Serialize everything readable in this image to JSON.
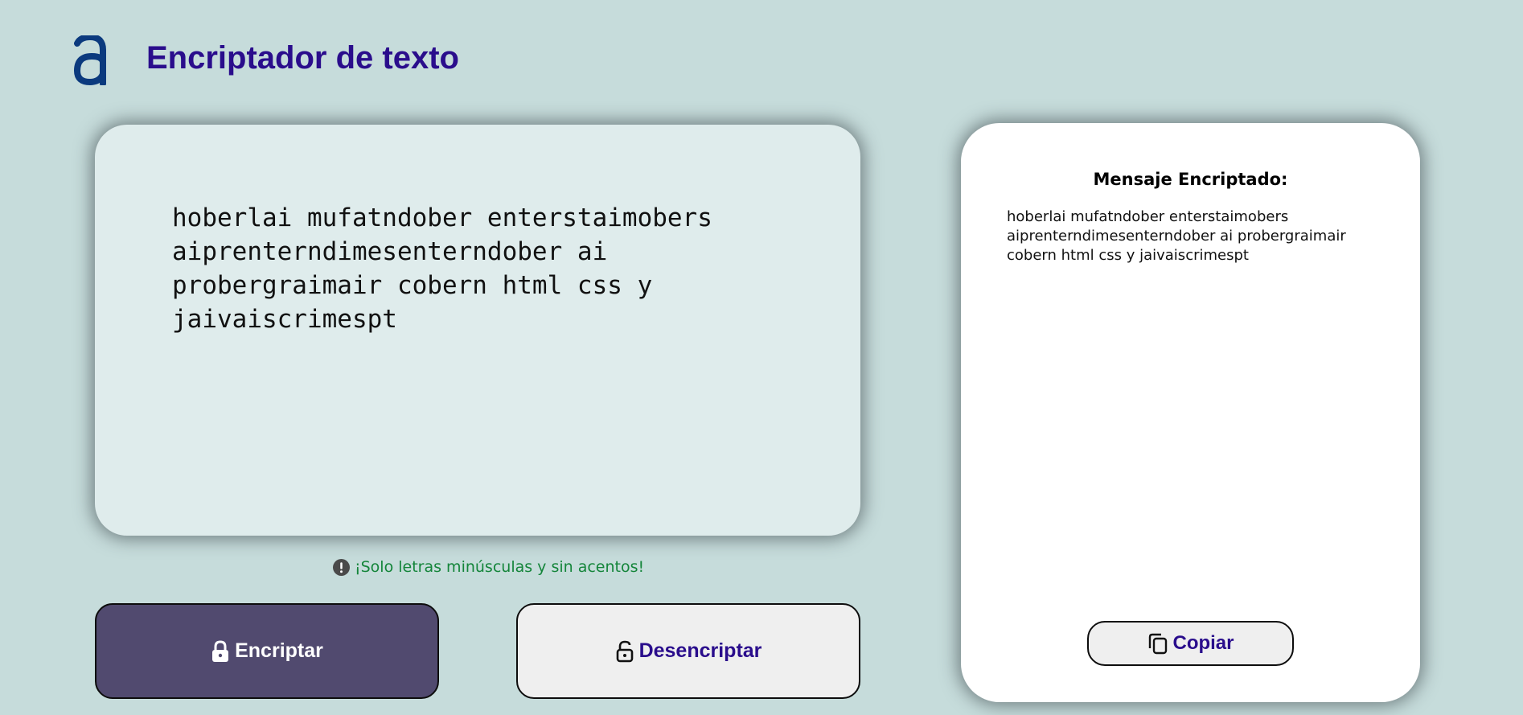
{
  "header": {
    "logo_icon": "alura-a-logo-icon",
    "title": "Encriptador de texto",
    "title_color": "#2a0d8c"
  },
  "input": {
    "value": "hoberlai mufatndober enterstaimobers aiprenterndimesenterndober ai probergraimair cobern html css y jaivaiscrimespt"
  },
  "hint": {
    "icon": "exclamation-circle-icon",
    "text": "¡Solo letras minúsculas y sin acentos!",
    "color": "#14853a"
  },
  "buttons": {
    "encrypt": {
      "label": "Encriptar",
      "icon": "lock-icon",
      "bg": "#514a6f"
    },
    "decrypt": {
      "label": "Desencriptar",
      "icon": "unlock-icon",
      "bg": "#efefef"
    }
  },
  "output": {
    "title": "Mensaje Encriptado:",
    "text": "hoberlai mufatndober enterstaimobers aiprenterndimesenterndober ai probergraimair cobern html css y jaivaiscrimespt",
    "copy_label": "Copiar",
    "copy_icon": "copy-icon"
  }
}
